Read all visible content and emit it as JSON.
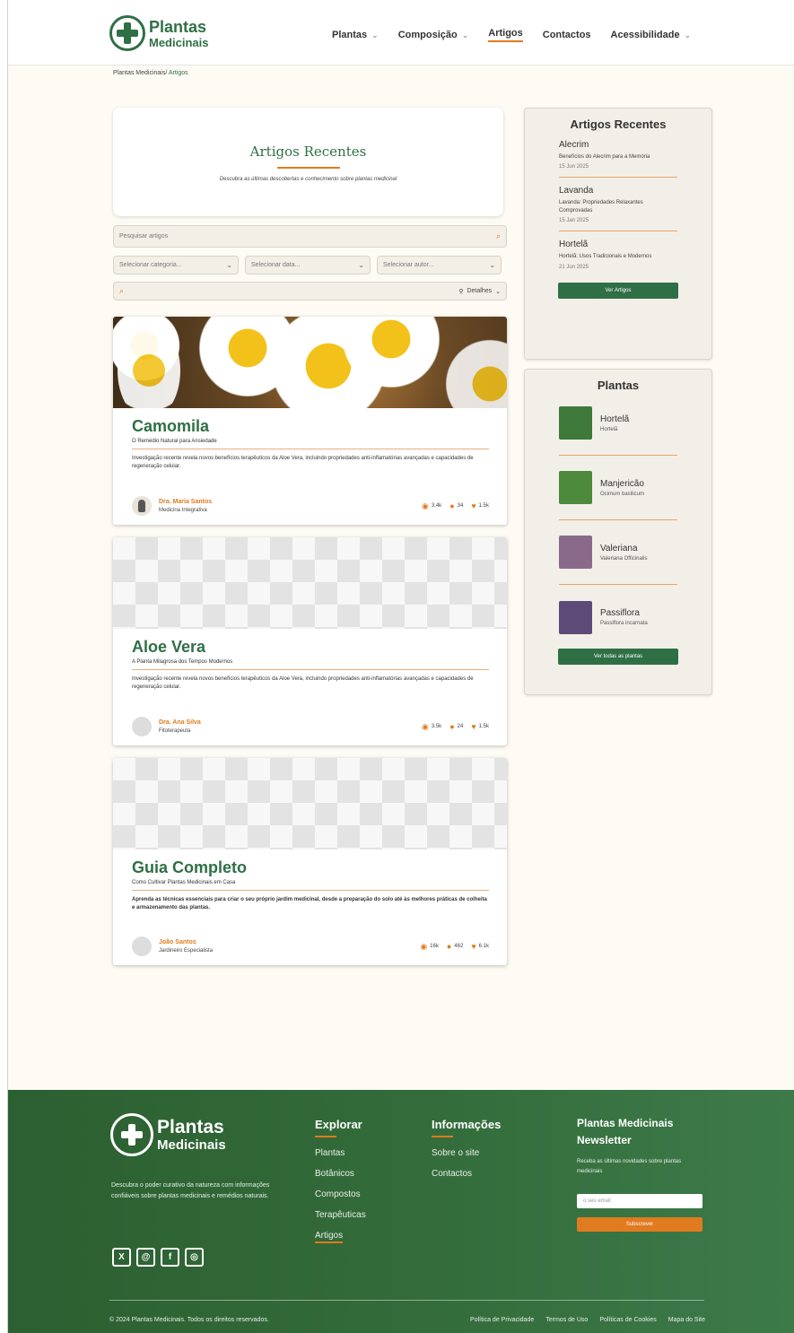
{
  "brand": {
    "line1": "Plantas",
    "line2": "Medicinais"
  },
  "nav": [
    {
      "label": "Plantas",
      "dropdown": true
    },
    {
      "label": "Composição",
      "dropdown": true
    },
    {
      "label": "Artigos",
      "dropdown": false,
      "active": true
    },
    {
      "label": "Contactos",
      "dropdown": false
    },
    {
      "label": "Acessibilidade",
      "dropdown": true
    }
  ],
  "breadcrumb": {
    "root": "Plantas Medicinais",
    "sep": "/",
    "current": "Artigos"
  },
  "hero": {
    "title": "Artigos Recentes",
    "subtitle": "Descubra as últimas descobertas e conhecimento sobre plantas medicinal"
  },
  "filters": {
    "search_placeholder": "Pesquisar artigos",
    "category": "Selecionar categoria...",
    "date": "Selecionar data...",
    "author": "Selecionar autor...",
    "details": "Detalhes"
  },
  "articles": [
    {
      "title": "Camomila",
      "subtitle": "O Remédio Natural para Ansiedade",
      "description": "Investigação recente revela novos benefícios terapêuticos da Aloe Vera, incluindo propriedades anti-inflamatórias avançadas e capacidades de regeneração celular.",
      "author": "Dra. Maria Santos",
      "role": "Medicina Integrativa",
      "views": "3.4k",
      "comments": "34",
      "likes": "1.5k"
    },
    {
      "title": "Aloe Vera",
      "subtitle": "A Planta Milagrosa dos Tempos Modernos",
      "description": "Investigação recente revela novos benefícios terapêuticos da Aloe Vera, incluindo propriedades anti-inflamatórias avançadas e capacidades de regeneração celular.",
      "author": "Dra. Ana Silva",
      "role": "Fitoterapeuta",
      "views": "3.5k",
      "comments": "24",
      "likes": "1.5k"
    },
    {
      "title": "Guia Completo",
      "subtitle": "Como Cultivar Plantas Medicinais em Casa",
      "description": "Aprenda as técnicas essenciais para criar o seu próprio jardim medicinal, desde a preparação do solo até às melhores práticas de colheita e armazenamento das plantas.",
      "author": "João Santos",
      "role": "Jardineiro Especialista",
      "views": "16k",
      "comments": "462",
      "likes": "6.1k"
    }
  ],
  "recent_sidebar": {
    "title": "Artigos Recentes",
    "items": [
      {
        "title": "Alecrim",
        "desc": "Benefícios do Alecrim para a Memória",
        "date": "15 Jun 2025"
      },
      {
        "title": "Lavanda",
        "desc": "Lavanda: Propriedades Relaxantes Comprovadas",
        "date": "15 Jan 2025"
      },
      {
        "title": "Hortelã",
        "desc": "Hortelã: Usos Tradicionais e Modernos",
        "date": "21 Jun 2025"
      }
    ],
    "button": "Ver Artigos"
  },
  "plants_sidebar": {
    "title": "Plantas",
    "items": [
      {
        "name": "Hortelã",
        "scientific": "Hortelã",
        "color": "#3f7a3a"
      },
      {
        "name": "Manjericão",
        "scientific": "Ocimum basilicum",
        "color": "#4d8a3b"
      },
      {
        "name": "Valeriana",
        "scientific": "Valeriana Officinalis",
        "color": "#8a6a8a"
      },
      {
        "name": "Passiflora",
        "scientific": "Passiflora incarnata",
        "color": "#5d4a78"
      }
    ],
    "button": "Ver todas as plantas"
  },
  "footer": {
    "description": "Descubra o poder curativo da natureza com informações confiáveis sobre plantas medicinais e remédios naturais.",
    "socials": [
      "x-icon",
      "threads-icon",
      "facebook-icon",
      "instagram-icon"
    ],
    "explore": {
      "title": "Explorar",
      "links": [
        "Plantas",
        "Botânicos",
        "Compostos",
        "Terapêuticas",
        "Artigos"
      ]
    },
    "info": {
      "title": "Informações",
      "links": [
        "Sobre o site",
        "Contactos"
      ]
    },
    "newsletter": {
      "title": "Plantas Medicinais Newsletter",
      "text": "Receba as últimas novidades sobre plantas medicinais",
      "placeholder": "o seu email",
      "button": "Subscrever"
    },
    "copyright": "© 2024 Plantas Medicinais. Todos os direitos reservados.",
    "legal": [
      "Política de Privacidade",
      "Termos de Uso",
      "Políticas de Cookies",
      "Mapa do Site"
    ]
  },
  "colors": {
    "primary": "#2f6f45",
    "accent": "#e07b1f",
    "background": "#fdfbf4"
  }
}
